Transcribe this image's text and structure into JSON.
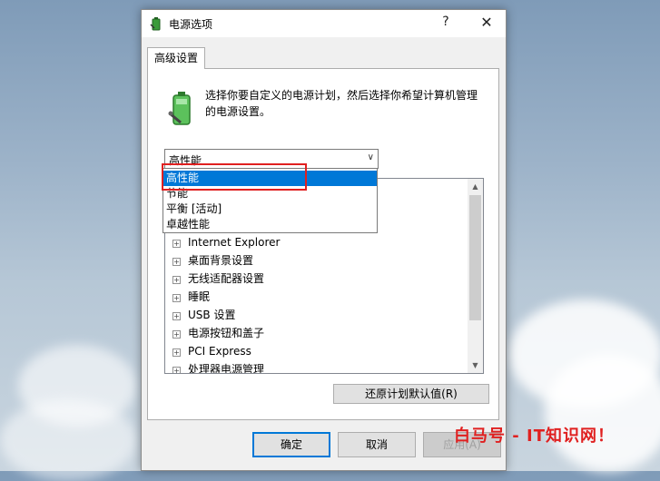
{
  "window": {
    "title": "电源选项",
    "help_label": "?",
    "close_label": "✕"
  },
  "tabs": [
    {
      "label": "高级设置"
    }
  ],
  "description": "选择你要自定义的电源计划，然后选择你希望计算机管理的电源设置。",
  "plan_combo": {
    "value": "高性能",
    "options": [
      {
        "label": "高性能",
        "selected": true
      },
      {
        "label": "节能",
        "selected": false
      },
      {
        "label": "平衡 [活动]",
        "selected": false
      },
      {
        "label": "卓越性能",
        "selected": false
      }
    ]
  },
  "settings_tree": [
    {
      "label": "Internet Explorer"
    },
    {
      "label": "桌面背景设置"
    },
    {
      "label": "无线适配器设置"
    },
    {
      "label": "睡眠"
    },
    {
      "label": "USB 设置"
    },
    {
      "label": "电源按钮和盖子"
    },
    {
      "label": "PCI Express"
    },
    {
      "label": "处理器电源管理"
    }
  ],
  "restore_button": "还原计划默认值(R)",
  "footer": {
    "ok": "确定",
    "cancel": "取消",
    "apply": "应用(A)"
  },
  "watermark": "白马号 - IT知识网！",
  "colors": {
    "selection": "#0078d7",
    "annotation": "#e02020"
  }
}
